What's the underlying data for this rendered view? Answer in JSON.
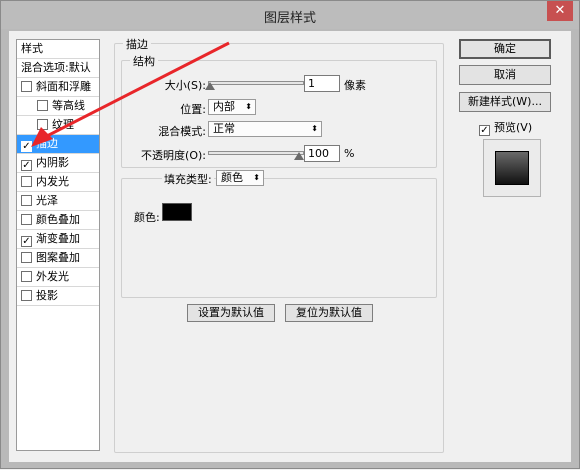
{
  "window": {
    "title": "图层样式",
    "close_label": "✕"
  },
  "sidebar": {
    "header": "样式",
    "items": [
      {
        "label": "混合选项:默认",
        "has_checkbox": false,
        "checked": false,
        "indent": false,
        "selected": false
      },
      {
        "label": "斜面和浮雕",
        "has_checkbox": true,
        "checked": false,
        "indent": false,
        "selected": false
      },
      {
        "label": "等高线",
        "has_checkbox": true,
        "checked": false,
        "indent": true,
        "selected": false
      },
      {
        "label": "纹理",
        "has_checkbox": true,
        "checked": false,
        "indent": true,
        "selected": false
      },
      {
        "label": "描边",
        "has_checkbox": true,
        "checked": true,
        "indent": false,
        "selected": true
      },
      {
        "label": "内阴影",
        "has_checkbox": true,
        "checked": true,
        "indent": false,
        "selected": false
      },
      {
        "label": "内发光",
        "has_checkbox": true,
        "checked": false,
        "indent": false,
        "selected": false
      },
      {
        "label": "光泽",
        "has_checkbox": true,
        "checked": false,
        "indent": false,
        "selected": false
      },
      {
        "label": "颜色叠加",
        "has_checkbox": true,
        "checked": false,
        "indent": false,
        "selected": false
      },
      {
        "label": "渐变叠加",
        "has_checkbox": true,
        "checked": true,
        "indent": false,
        "selected": false
      },
      {
        "label": "图案叠加",
        "has_checkbox": true,
        "checked": false,
        "indent": false,
        "selected": false
      },
      {
        "label": "外发光",
        "has_checkbox": true,
        "checked": false,
        "indent": false,
        "selected": false
      },
      {
        "label": "投影",
        "has_checkbox": true,
        "checked": false,
        "indent": false,
        "selected": false
      }
    ]
  },
  "stroke": {
    "section_title": "描边",
    "structure_title": "结构",
    "size_label": "大小(S):",
    "size_value": "1",
    "size_unit": "像素",
    "position_label": "位置:",
    "position_value": "内部",
    "blend_label": "混合模式:",
    "blend_value": "正常",
    "opacity_label": "不透明度(O):",
    "opacity_value": "100",
    "opacity_unit": "%",
    "fill_type_label": "填充类型:",
    "fill_type_value": "颜色",
    "color_label": "颜色:",
    "color_hex": "#000000",
    "set_default_label": "设置为默认值",
    "reset_default_label": "复位为默认值"
  },
  "buttons": {
    "ok": "确定",
    "cancel": "取消",
    "new_style": "新建样式(W)...",
    "preview_label": "预览(V)",
    "preview_checked": true
  },
  "annotation": {
    "arrow_color": "#e8262a"
  }
}
